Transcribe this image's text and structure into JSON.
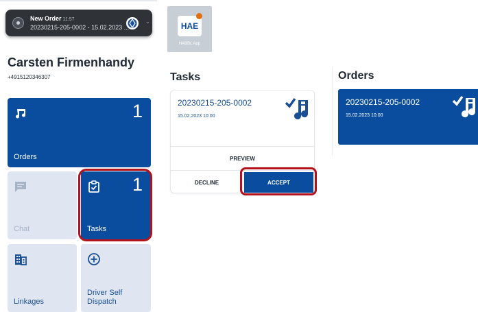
{
  "notification": {
    "title": "New Order",
    "time": "11:57",
    "body": "20230215-205-0002 - 15.02.2023 ..."
  },
  "user": {
    "name": "Carsten Firmenhandy",
    "phone": "+4915120346307"
  },
  "tiles": {
    "orders": {
      "label": "Orders",
      "count": "1",
      "icon": "music-note-icon"
    },
    "chat": {
      "label": "Chat",
      "icon": "chat-icon"
    },
    "tasks": {
      "label": "Tasks",
      "count": "1",
      "icon": "checklist-icon"
    },
    "linkages": {
      "label": "Linkages",
      "icon": "building-icon"
    },
    "driver_self_dispatch": {
      "label_line1": "Driver Self",
      "label_line2": "Dispatch",
      "icon": "plus-circle-icon"
    }
  },
  "app_icon": {
    "caption": "HABBL App"
  },
  "tasks": {
    "title": "Tasks",
    "card": {
      "id": "20230215-205-0002",
      "date": "15.02.2023 10:00",
      "preview_label": "PREVIEW",
      "decline_label": "DECLINE",
      "accept_label": "ACCEPT"
    }
  },
  "orders": {
    "title": "Orders",
    "card": {
      "id": "20230215-205-0002",
      "date": "15.02.2023 10:00"
    }
  },
  "colors": {
    "primary_blue": "#0a4d9e",
    "light_tile": "#dfe6f2",
    "highlight_red": "#b3121c"
  }
}
